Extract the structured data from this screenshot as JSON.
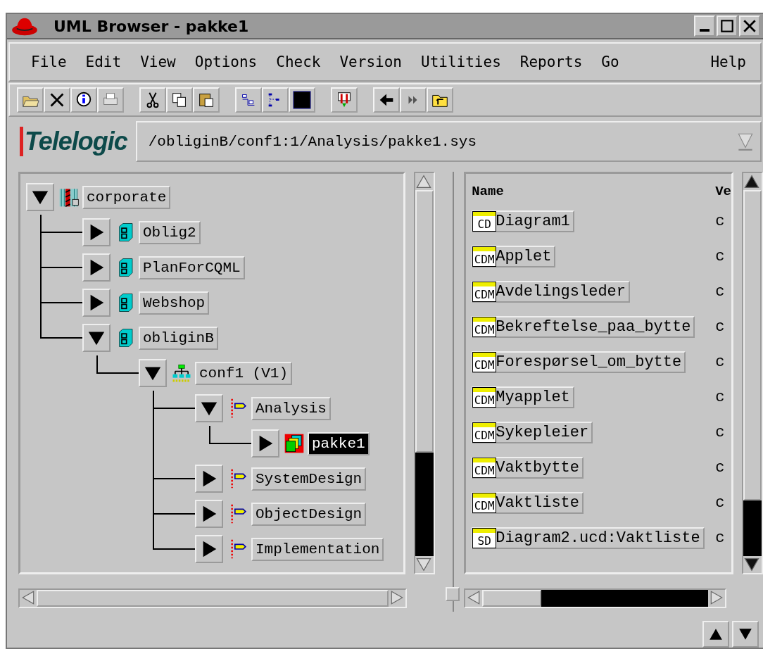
{
  "window": {
    "title": "UML Browser - pakke1"
  },
  "menu": [
    "File",
    "Edit",
    "View",
    "Options",
    "Check",
    "Version",
    "Utilities",
    "Reports",
    "Go",
    "Help"
  ],
  "logo": "Telelogic",
  "path_field": {
    "value": "/obliginB/conf1:1/Analysis/pakke1.sys"
  },
  "tree": [
    {
      "label": "corporate",
      "kind": "system",
      "expanded": true,
      "selected": false,
      "children": [
        {
          "label": "Oblig2",
          "kind": "database",
          "expanded": false,
          "selected": false
        },
        {
          "label": "PlanForCQML",
          "kind": "database",
          "expanded": false,
          "selected": false
        },
        {
          "label": "Webshop",
          "kind": "database",
          "expanded": false,
          "selected": false
        },
        {
          "label": "obliginB",
          "kind": "database",
          "expanded": true,
          "selected": false,
          "children": [
            {
              "label": "conf1 (V1)",
              "kind": "config",
              "expanded": true,
              "selected": false,
              "children": [
                {
                  "label": "Analysis",
                  "kind": "phase",
                  "expanded": true,
                  "selected": false,
                  "children": [
                    {
                      "label": "pakke1",
                      "kind": "package",
                      "expanded": false,
                      "selected": true
                    }
                  ]
                },
                {
                  "label": "SystemDesign",
                  "kind": "phase",
                  "expanded": false,
                  "selected": false
                },
                {
                  "label": "ObjectDesign",
                  "kind": "phase",
                  "expanded": false,
                  "selected": false
                },
                {
                  "label": "Implementation",
                  "kind": "phase",
                  "expanded": false,
                  "selected": false
                }
              ]
            }
          ]
        }
      ]
    }
  ],
  "list": {
    "columns": [
      "Name",
      "Ve"
    ],
    "rows": [
      {
        "badge": "CD",
        "name": "Diagram1",
        "version": "c"
      },
      {
        "badge": "CDM",
        "name": "Applet",
        "version": "c"
      },
      {
        "badge": "CDM",
        "name": "Avdelingsleder",
        "version": "c"
      },
      {
        "badge": "CDM",
        "name": "Bekreftelse_paa_bytte",
        "version": "c"
      },
      {
        "badge": "CDM",
        "name": "Forespørsel_om_bytte",
        "version": "c"
      },
      {
        "badge": "CDM",
        "name": "Myapplet",
        "version": "c"
      },
      {
        "badge": "CDM",
        "name": "Sykepleier",
        "version": "c"
      },
      {
        "badge": "CDM",
        "name": "Vaktbytte",
        "version": "c"
      },
      {
        "badge": "CDM",
        "name": "Vaktliste",
        "version": "c"
      },
      {
        "badge": "SD",
        "name": "Diagram2.ucd:Vaktliste",
        "version": "c"
      }
    ]
  }
}
